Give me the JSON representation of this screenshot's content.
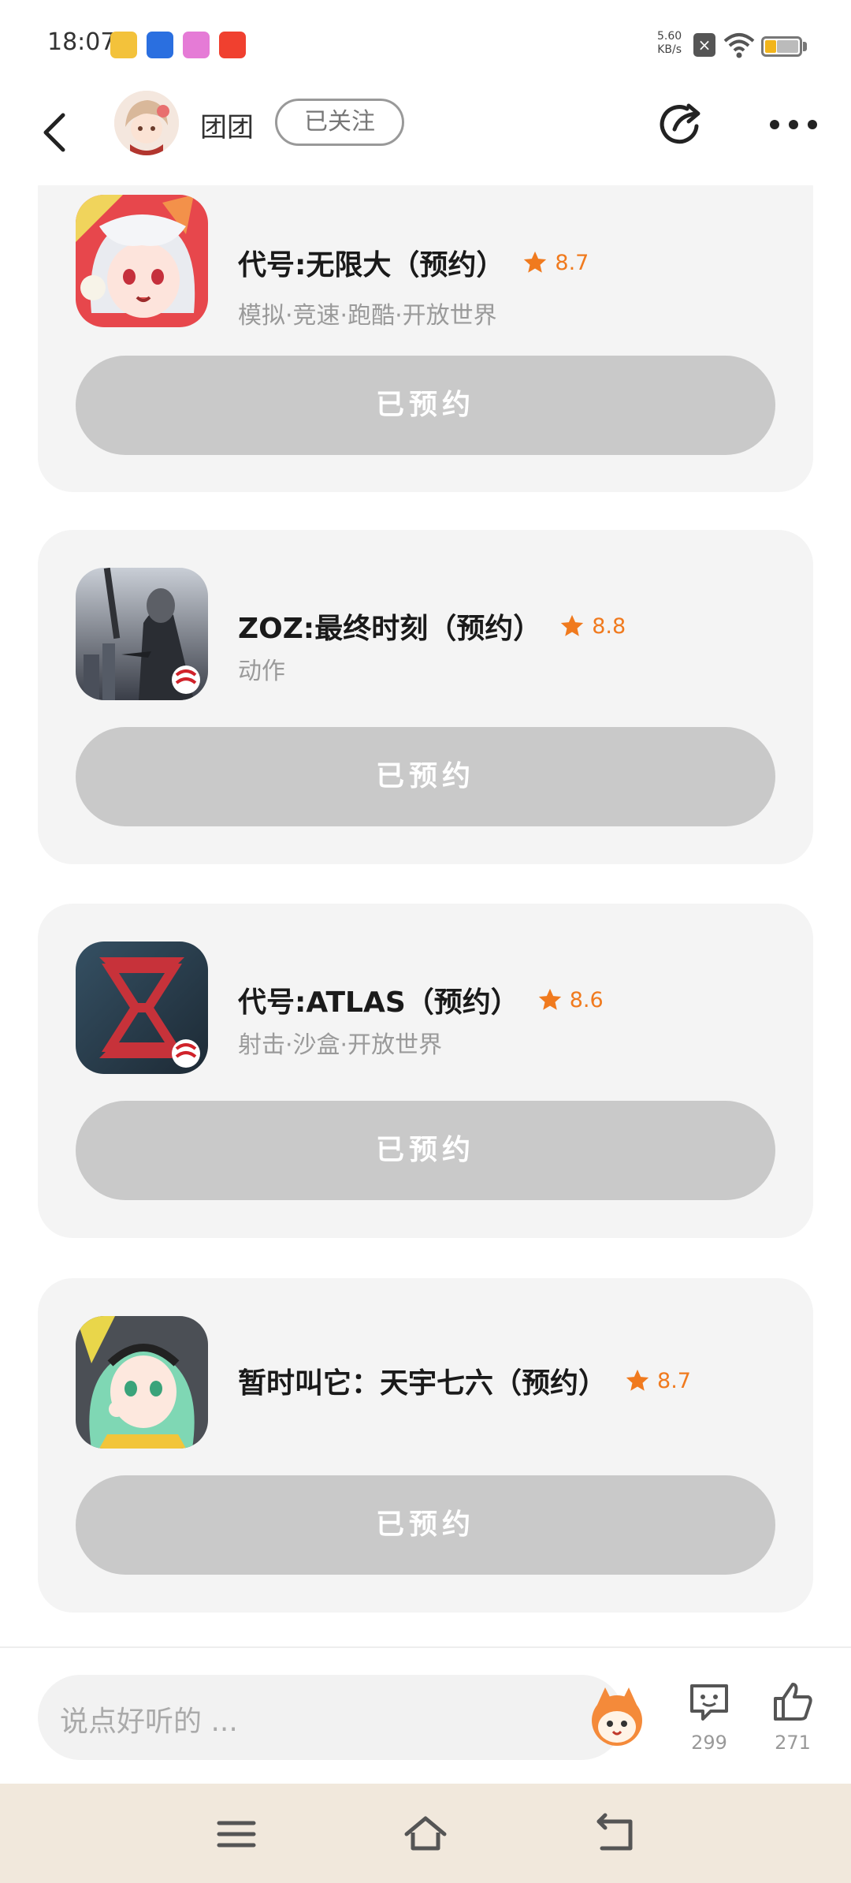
{
  "status_bar": {
    "time": "18:07",
    "net_speed_value": "5.60",
    "net_speed_unit": "KB/s",
    "app_icons": [
      "#f3c23b",
      "#2a6fe0",
      "#e57bd6",
      "#f0402f"
    ]
  },
  "header": {
    "username": "团团",
    "follow_label": "已关注"
  },
  "games": [
    {
      "title": "代号:无限大（预约）",
      "rating": "8.7",
      "tags": "模拟·竞速·跑酷·开放世界",
      "button": "已预约",
      "icon": "anime-girl-icon"
    },
    {
      "title": "ZOZ:最终时刻（预约）",
      "rating": "8.8",
      "tags": "动作",
      "button": "已预约",
      "icon": "soldier-game-icon"
    },
    {
      "title": "代号:ATLAS（预约）",
      "rating": "8.6",
      "tags": "射击·沙盒·开放世界",
      "button": "已预约",
      "icon": "atlas-game-icon"
    },
    {
      "title": "暂时叫它：天宇七六（预约）",
      "rating": "8.7",
      "tags": "",
      "button": "已预约",
      "icon": "green-hair-girl-icon"
    }
  ],
  "bottom_bar": {
    "comment_placeholder": "说点好听的 ...",
    "comment_count": "299",
    "like_count": "271"
  },
  "colors": {
    "accent": "#f07a1e",
    "card_bg": "#f4f4f4",
    "button_bg": "#c9c9c9",
    "nav_bg": "#f1e8dc"
  }
}
